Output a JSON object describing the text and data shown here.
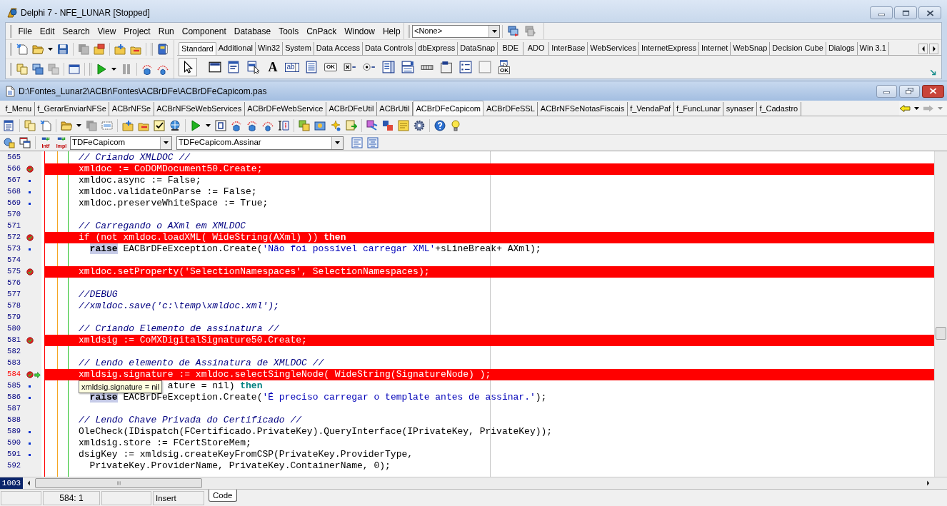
{
  "main_window": {
    "title": "Delphi 7 - NFE_LUNAR [Stopped]"
  },
  "menu_bar": [
    "File",
    "Edit",
    "Search",
    "View",
    "Project",
    "Run",
    "Component",
    "Database",
    "Tools",
    "CnPack",
    "Window",
    "Help"
  ],
  "desktop_combo": {
    "value": "<None>"
  },
  "palette": {
    "tabs": [
      {
        "label": "Standard",
        "selected": true
      },
      {
        "label": "Additional",
        "selected": false
      },
      {
        "label": "Win32",
        "selected": false
      },
      {
        "label": "System",
        "selected": false
      },
      {
        "label": "Data Access",
        "selected": false
      },
      {
        "label": "Data Controls",
        "selected": false
      },
      {
        "label": "dbExpress",
        "selected": false
      },
      {
        "label": "DataSnap",
        "selected": false
      },
      {
        "label": "BDE",
        "selected": false
      },
      {
        "label": "ADO",
        "selected": false
      },
      {
        "label": "InterBase",
        "selected": false
      },
      {
        "label": "WebServices",
        "selected": false
      },
      {
        "label": "InternetExpress",
        "selected": false
      },
      {
        "label": "Internet",
        "selected": false
      },
      {
        "label": "WebSnap",
        "selected": false
      },
      {
        "label": "Decision Cube",
        "selected": false
      },
      {
        "label": "Dialogs",
        "selected": false
      },
      {
        "label": "Win 3.1",
        "selected": false
      }
    ],
    "components": [
      {
        "kind": "pointer",
        "selected": true
      },
      {
        "kind": "frame",
        "selected": false
      },
      {
        "kind": "main_menu",
        "selected": false
      },
      {
        "kind": "popup_menu",
        "selected": false
      },
      {
        "kind": "label",
        "glyph": "A",
        "selected": false
      },
      {
        "kind": "edit",
        "glyph": "ab",
        "selected": false
      },
      {
        "kind": "memo",
        "selected": false
      },
      {
        "kind": "button",
        "glyph": "OK",
        "selected": false
      },
      {
        "kind": "checkbox",
        "selected": false
      },
      {
        "kind": "radio",
        "selected": false
      },
      {
        "kind": "listbox",
        "selected": false
      },
      {
        "kind": "combobox",
        "selected": false
      },
      {
        "kind": "scrollbar",
        "selected": false
      },
      {
        "kind": "groupbox",
        "selected": false
      },
      {
        "kind": "radiogroup",
        "selected": false
      },
      {
        "kind": "panel",
        "selected": false
      },
      {
        "kind": "action_list",
        "glyph": "OK",
        "selected": false
      }
    ]
  },
  "editor": {
    "title": "D:\\Fontes_Lunar2\\ACBr\\Fontes\\ACBrDFe\\ACBrDFeCapicom.pas",
    "tabs": [
      {
        "label": "f_Menu",
        "selected": false
      },
      {
        "label": "f_GerarEnviarNFSe",
        "selected": false
      },
      {
        "label": "ACBrNFSe",
        "selected": false
      },
      {
        "label": "ACBrNFSeWebServices",
        "selected": false
      },
      {
        "label": "ACBrDFeWebService",
        "selected": false
      },
      {
        "label": "ACBrDFeUtil",
        "selected": false
      },
      {
        "label": "ACBrUtil",
        "selected": false
      },
      {
        "label": "ACBrDFeCapicom",
        "selected": true
      },
      {
        "label": "ACBrDFeSSL",
        "selected": false
      },
      {
        "label": "ACBrNFSeNotasFiscais",
        "selected": false
      },
      {
        "label": "f_VendaPaf",
        "selected": false
      },
      {
        "label": "f_FuncLunar",
        "selected": false
      },
      {
        "label": "synaser",
        "selected": false
      },
      {
        "label": "f_Cadastro",
        "selected": false
      }
    ],
    "toolbar": {
      "intf_label": "Intf",
      "impl_label": "Impl",
      "class_combo": "TDFeCapicom",
      "method_combo": "TDFeCapicom.Assinar"
    },
    "lines": [
      {
        "number": "565",
        "kind": "other",
        "current": false,
        "segments": [
          {
            "kind": "comment",
            "text": "// Criando XMLDOC //"
          }
        ]
      },
      {
        "number": "566",
        "kind": "breakpoint",
        "current": false,
        "segments": [
          {
            "kind": "plain",
            "text": "xmldoc := CoDOMDocument50.Create;"
          }
        ]
      },
      {
        "number": "567",
        "kind": "executable",
        "current": false,
        "segments": [
          {
            "kind": "plain",
            "text": "xmldoc.async := False;"
          }
        ]
      },
      {
        "number": "568",
        "kind": "executable",
        "current": false,
        "segments": [
          {
            "kind": "plain",
            "text": "xmldoc.validateOnParse := False;"
          }
        ]
      },
      {
        "number": "569",
        "kind": "executable",
        "current": false,
        "segments": [
          {
            "kind": "plain",
            "text": "xmldoc.preserveWhiteSpace := True;"
          }
        ]
      },
      {
        "number": "570",
        "kind": "other",
        "current": false
      },
      {
        "number": "571",
        "kind": "other",
        "current": false,
        "segments": [
          {
            "kind": "comment",
            "text": "// Carregando o AXml em XMLDOC"
          }
        ]
      },
      {
        "number": "572",
        "kind": "breakpoint",
        "current": false,
        "segments": [
          {
            "kind": "plain",
            "text": "if (not xmldoc.loadXML( WideString(AXml) )) "
          },
          {
            "kind": "keyword",
            "text": "then"
          }
        ]
      },
      {
        "number": "573",
        "kind": "executable",
        "current": false,
        "segments": [
          {
            "kind": "marked",
            "text": "  raise"
          },
          {
            "kind": "plain",
            "text": " EACBrDFeException.Create("
          },
          {
            "kind": "string",
            "text": "'Não foi possível carregar XML'"
          },
          {
            "kind": "plain",
            "text": "+sLineBreak+ AXml);"
          }
        ]
      },
      {
        "number": "574",
        "kind": "other",
        "current": false
      },
      {
        "number": "575",
        "kind": "breakpoint",
        "current": false,
        "segments": [
          {
            "kind": "plain",
            "text": "xmldoc.setProperty("
          },
          {
            "kind": "string",
            "text": "'SelectionNamespaces'"
          },
          {
            "kind": "plain",
            "text": ", SelectionNamespaces);"
          }
        ]
      },
      {
        "number": "576",
        "kind": "other",
        "current": false
      },
      {
        "number": "577",
        "kind": "other",
        "current": false,
        "segments": [
          {
            "kind": "comment",
            "text": "//DEBUG"
          }
        ]
      },
      {
        "number": "578",
        "kind": "other",
        "current": false,
        "segments": [
          {
            "kind": "comment",
            "text": "//xmldoc.save('c:\\temp\\xmldoc.xml');"
          }
        ]
      },
      {
        "number": "579",
        "kind": "other",
        "current": false
      },
      {
        "number": "580",
        "kind": "other",
        "current": false,
        "segments": [
          {
            "kind": "comment",
            "text": "// Criando Elemento de assinatura //"
          }
        ]
      },
      {
        "number": "581",
        "kind": "breakpoint",
        "current": false,
        "segments": [
          {
            "kind": "plain",
            "text": "xmldsig := CoMXDigitalSignature50.Create;"
          }
        ]
      },
      {
        "number": "582",
        "kind": "other",
        "current": false
      },
      {
        "number": "583",
        "kind": "other",
        "current": false,
        "segments": [
          {
            "kind": "comment",
            "text": "// Lendo elemento de Assinatura de XMLDOC //"
          }
        ]
      },
      {
        "number": "584",
        "kind": "breakpoint",
        "current": true,
        "segments": [
          {
            "kind": "plain",
            "text": "xmldsig.signature := xmldoc.selectSingleNode( WideString(SignatureNode) );"
          }
        ]
      },
      {
        "number": "585",
        "kind": "executable",
        "current": false,
        "tooltip": "xmldsig.signature = nil",
        "segments": [
          {
            "kind": "plain",
            "text": "                ature = nil) "
          },
          {
            "kind": "match",
            "text": "then"
          }
        ]
      },
      {
        "number": "586",
        "kind": "executable",
        "current": false,
        "segments": [
          {
            "kind": "marked",
            "text": "  raise"
          },
          {
            "kind": "plain",
            "text": " EACBrDFeException.Create("
          },
          {
            "kind": "string",
            "text": "'É preciso carregar o template antes de assinar.'"
          },
          {
            "kind": "plain",
            "text": ");"
          }
        ]
      },
      {
        "number": "587",
        "kind": "other",
        "current": false
      },
      {
        "number": "588",
        "kind": "other",
        "current": false,
        "segments": [
          {
            "kind": "comment",
            "text": "// Lendo Chave Privada do Certificado //"
          }
        ]
      },
      {
        "number": "589",
        "kind": "executable",
        "current": false,
        "segments": [
          {
            "kind": "plain",
            "text": "OleCheck(IDispatch(FCertificado.PrivateKey).QueryInterface(IPrivateKey, PrivateKey));"
          }
        ]
      },
      {
        "number": "590",
        "kind": "executable",
        "current": false,
        "segments": [
          {
            "kind": "plain",
            "text": "xmldsig.store := FCertStoreMem;"
          }
        ]
      },
      {
        "number": "591",
        "kind": "executable",
        "current": false,
        "segments": [
          {
            "kind": "plain",
            "text": "dsigKey := xmldsig.createKeyFromCSP(PrivateKey.ProviderType,"
          }
        ]
      },
      {
        "number": "592",
        "kind": "other",
        "current": false,
        "segments": [
          {
            "kind": "plain",
            "text": "  PrivateKey.ProviderName, PrivateKey.ContainerName, 0);"
          }
        ]
      }
    ],
    "line_total": "1003"
  },
  "status_bar": {
    "position": "584: 1",
    "mode": "Insert",
    "view_tabs": [
      {
        "label": "Code",
        "selected": true
      }
    ]
  }
}
